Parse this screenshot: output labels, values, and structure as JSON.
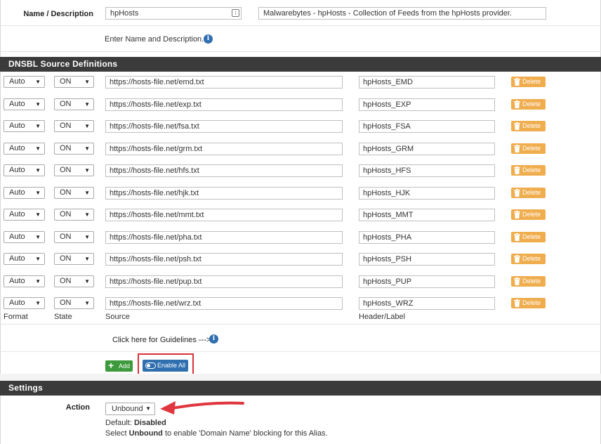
{
  "name_section": {
    "label": "Name / Description",
    "name_value": "hpHosts",
    "description_value": "Malwarebytes - hpHosts - Collection of Feeds from the hpHosts provider.",
    "help_text": "Enter Name and Description."
  },
  "dnsbl": {
    "title": "DNSBL Source Definitions",
    "rows": [
      {
        "format": "Auto",
        "state": "ON",
        "source": "https://hosts-file.net/emd.txt",
        "header": "hpHosts_EMD",
        "delete_label": "Delete"
      },
      {
        "format": "Auto",
        "state": "ON",
        "source": "https://hosts-file.net/exp.txt",
        "header": "hpHosts_EXP",
        "delete_label": "Delete"
      },
      {
        "format": "Auto",
        "state": "ON",
        "source": "https://hosts-file.net/fsa.txt",
        "header": "hpHosts_FSA",
        "delete_label": "Delete"
      },
      {
        "format": "Auto",
        "state": "ON",
        "source": "https://hosts-file.net/grm.txt",
        "header": "hpHosts_GRM",
        "delete_label": "Delete"
      },
      {
        "format": "Auto",
        "state": "ON",
        "source": "https://hosts-file.net/hfs.txt",
        "header": "hpHosts_HFS",
        "delete_label": "Delete"
      },
      {
        "format": "Auto",
        "state": "ON",
        "source": "https://hosts-file.net/hjk.txt",
        "header": "hpHosts_HJK",
        "delete_label": "Delete"
      },
      {
        "format": "Auto",
        "state": "ON",
        "source": "https://hosts-file.net/mmt.txt",
        "header": "hpHosts_MMT",
        "delete_label": "Delete"
      },
      {
        "format": "Auto",
        "state": "ON",
        "source": "https://hosts-file.net/pha.txt",
        "header": "hpHosts_PHA",
        "delete_label": "Delete"
      },
      {
        "format": "Auto",
        "state": "ON",
        "source": "https://hosts-file.net/psh.txt",
        "header": "hpHosts_PSH",
        "delete_label": "Delete"
      },
      {
        "format": "Auto",
        "state": "ON",
        "source": "https://hosts-file.net/pup.txt",
        "header": "hpHosts_PUP",
        "delete_label": "Delete"
      },
      {
        "format": "Auto",
        "state": "ON",
        "source": "https://hosts-file.net/wrz.txt",
        "header": "hpHosts_WRZ",
        "delete_label": "Delete"
      }
    ],
    "columns": {
      "format": "Format",
      "state": "State",
      "source": "Source",
      "header": "Header/Label"
    },
    "guidelines_text": "Click here for Guidelines --->",
    "add_label": "Add",
    "enable_all_label": "Enable All"
  },
  "settings": {
    "title": "Settings",
    "action_label": "Action",
    "action_value": "Unbound",
    "default_prefix": "Default: ",
    "default_value": "Disabled",
    "help_prefix": "Select ",
    "help_bold": "Unbound",
    "help_suffix": " to enable 'Domain Name' blocking for this Alias."
  },
  "icons": {
    "info": "info-circle-icon",
    "trash": "trash-icon",
    "plus": "plus-icon",
    "toggle": "toggle-icon",
    "caret": "caret-down-icon",
    "annotation_arrow": "red-arrow-icon"
  },
  "colors": {
    "section_bar": "#3b3b3b",
    "delete_button": "#f0ad4e",
    "add_button": "#3c9a3c",
    "enable_all_button": "#2f6fb0",
    "highlight": "#d9313a"
  }
}
